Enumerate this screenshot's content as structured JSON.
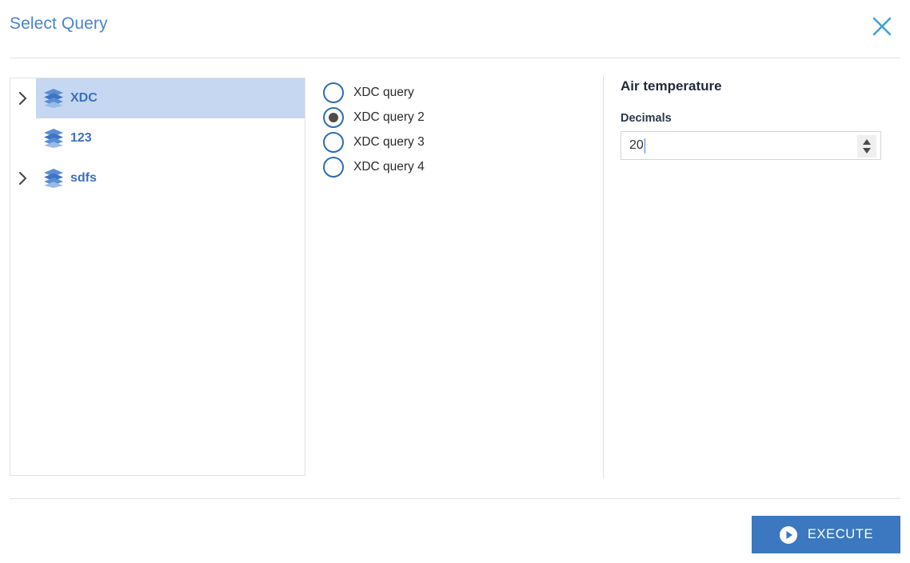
{
  "dialog": {
    "title": "Select Query",
    "close_icon": "close-x-icon"
  },
  "tree": {
    "items": [
      {
        "label": "XDC",
        "icon": "layers-stack-icon",
        "expandable": true,
        "selected": true
      },
      {
        "label": "123",
        "icon": "layers-stack-icon",
        "expandable": false,
        "selected": false
      },
      {
        "label": "sdfs",
        "icon": "layers-stack-icon",
        "expandable": true,
        "selected": false
      }
    ]
  },
  "queries": {
    "options": [
      {
        "label": "XDC query",
        "checked": false
      },
      {
        "label": "XDC query 2",
        "checked": true
      },
      {
        "label": "XDC query 3",
        "checked": false
      },
      {
        "label": "XDC query 4",
        "checked": false
      }
    ]
  },
  "details": {
    "title": "Air temperature",
    "decimals_label": "Decimals",
    "decimals_value": "20",
    "decimals_placeholder": ""
  },
  "footer": {
    "execute_label": "EXECUTE",
    "execute_icon": "play-circle-icon"
  },
  "colors": {
    "title_blue": "#4a84d1",
    "tree_label_blue": "#3c6fc2",
    "selection_blue": "#c5d7f1",
    "radio_blue": "#2e6db4",
    "radio_dot": "#4d4d4d",
    "button_blue": "#3b78bf",
    "close_blue": "#3fa0e0"
  }
}
